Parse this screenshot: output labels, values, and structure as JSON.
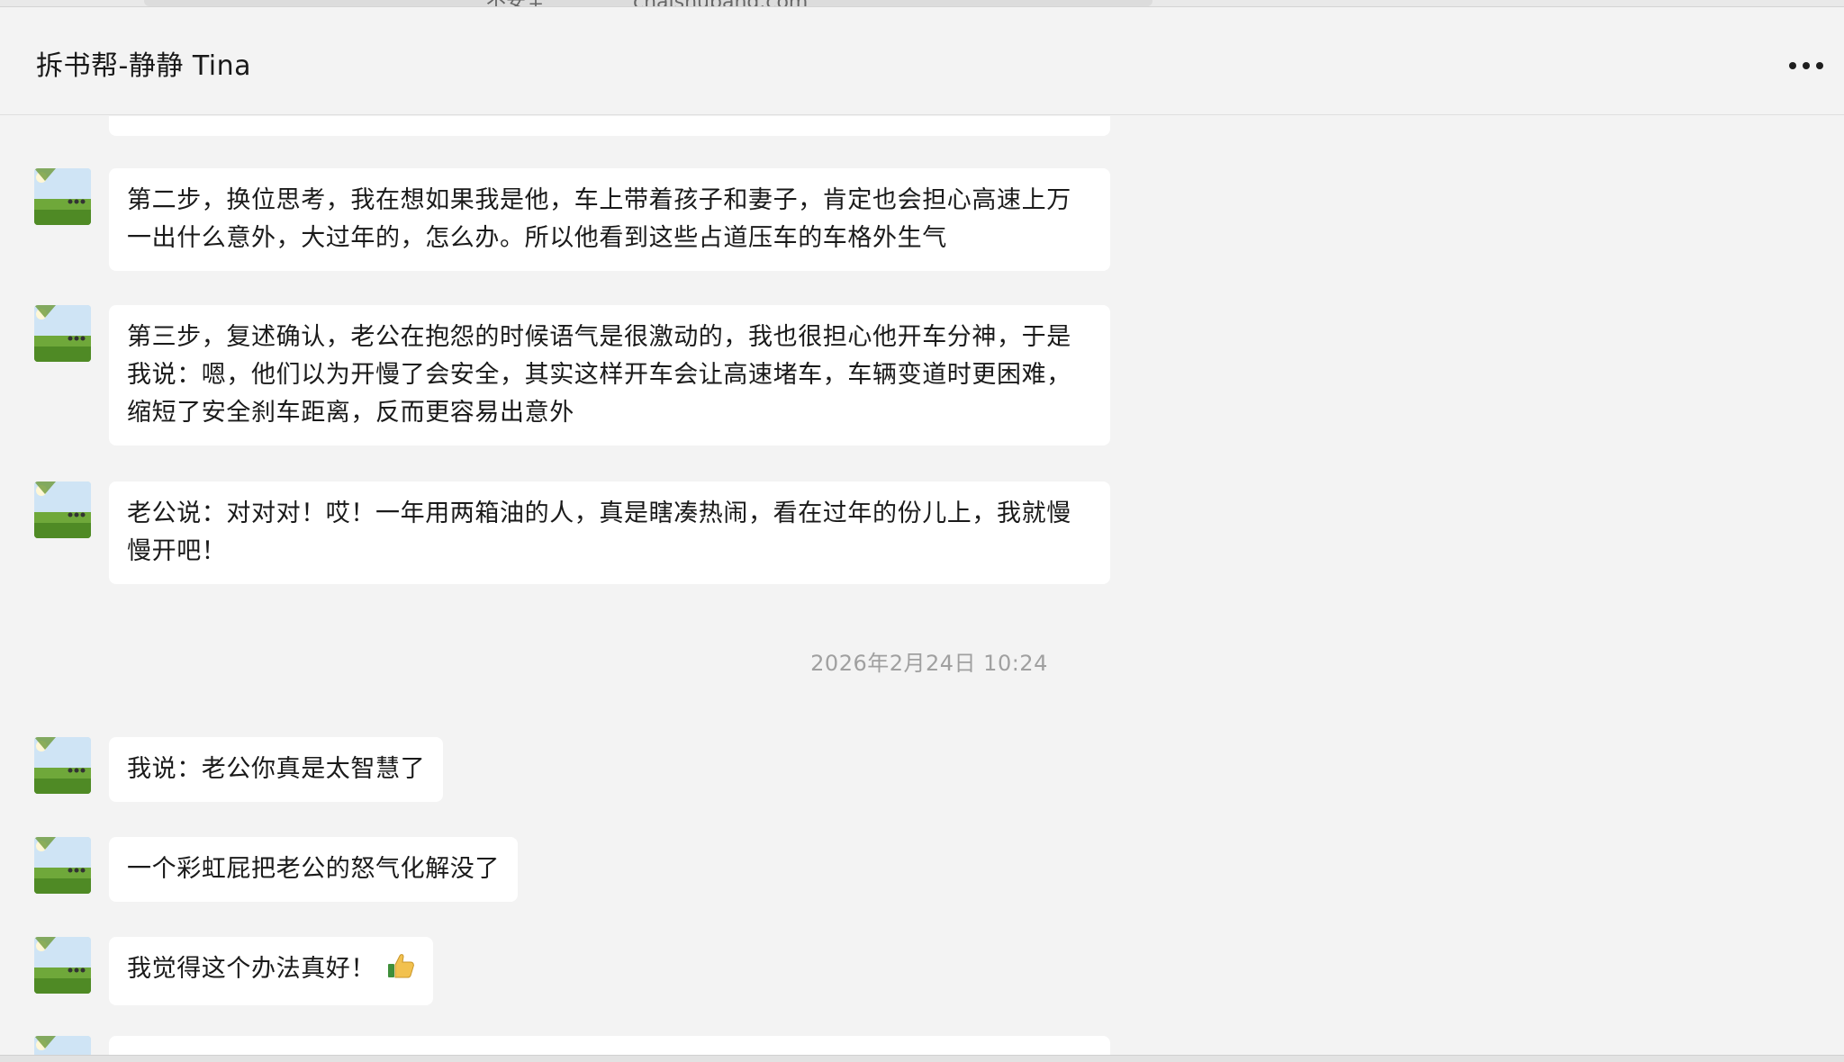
{
  "browser": {
    "url": "chaishubang.com",
    "security_label": "不安全"
  },
  "header": {
    "title": "拆书帮-静静 Tina",
    "more_icon": "more-dots-icon"
  },
  "messages": [
    {
      "sender": "静静 Tina",
      "text": "第二步，换位思考，我在想如果我是他，车上带着孩子和妻子，肯定也会担心高速上万一出什么意外，大过年的，怎么办。所以他看到这些占道压车的车格外生气"
    },
    {
      "sender": "静静 Tina",
      "text": "第三步，复述确认，老公在抱怨的时候语气是很激动的，我也很担心他开车分神，于是我说：嗯，他们以为开慢了会安全，其实这样开车会让高速堵车，车辆变道时更困难，缩短了安全刹车距离，反而更容易出意外"
    },
    {
      "sender": "静静 Tina",
      "text": "老公说：对对对！哎！一年用两箱油的人，真是瞎凑热闹，看在过年的份儿上，我就慢慢开吧！"
    },
    {
      "sender": "静静 Tina",
      "text": "我说：老公你真是太智慧了"
    },
    {
      "sender": "静静 Tina",
      "text": "一个彩虹屁把老公的怒气化解没了"
    },
    {
      "sender": "静静 Tina",
      "text": "我觉得这个办法真好！",
      "emoji": "thumbs-up-icon"
    }
  ],
  "timestamp": "2026年2月24日 10:24"
}
